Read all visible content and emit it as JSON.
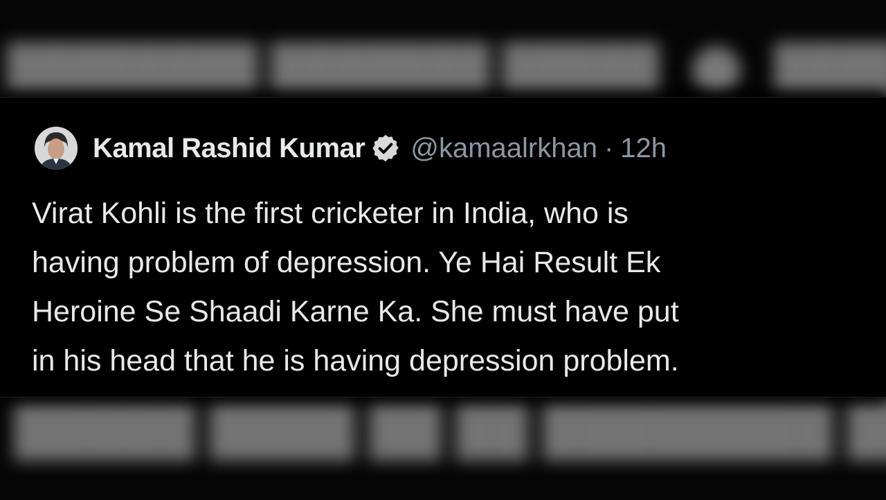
{
  "tweet": {
    "display_name": "Kamal Rashid Kumar",
    "handle": "@kamaalrkhan",
    "separator": "·",
    "time": "12h",
    "text_lines": [
      "Virat Kohli is the first cricketer in India, who is",
      "having problem of depression. Ye Hai Result Ek",
      "Heroine Se Shaadi Karne Ka. She must have put",
      "in his head that he is having depression problem."
    ]
  },
  "icons": {
    "avatar": "avatar",
    "verified": "verified-badge-icon"
  },
  "colors": {
    "background": "#000000",
    "primary_text": "#e7e9ea",
    "secondary_text": "#8b98a5",
    "badge": "#d9d9d9"
  }
}
